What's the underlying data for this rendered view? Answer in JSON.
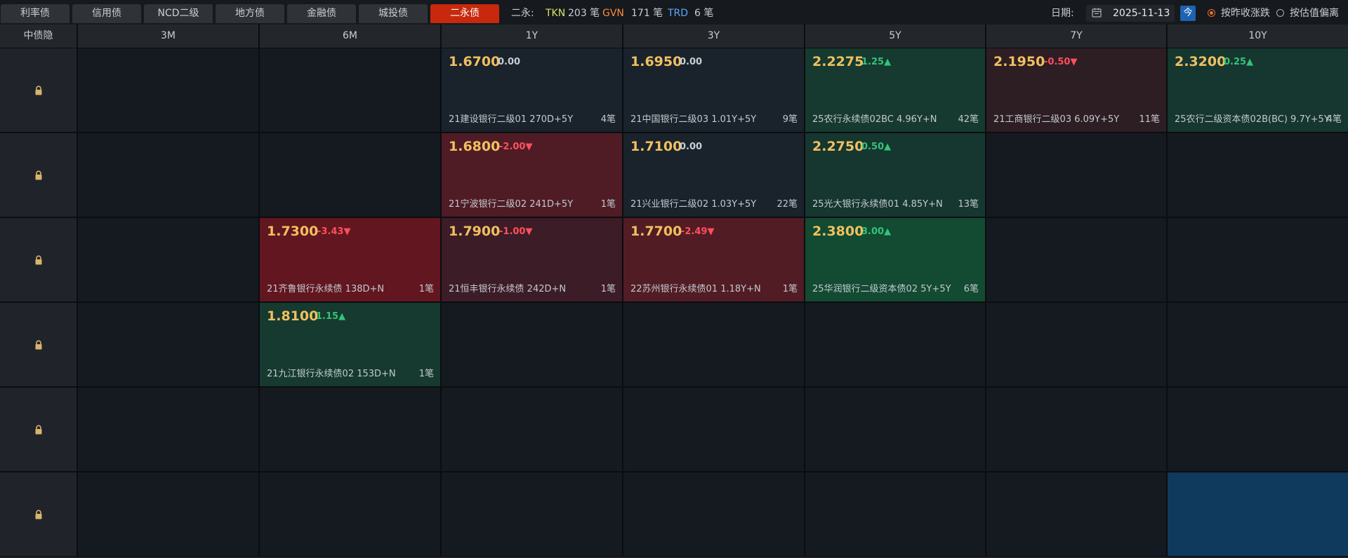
{
  "tabs": [
    {
      "label": "利率债",
      "active": false
    },
    {
      "label": "信用债",
      "active": false
    },
    {
      "label": "NCD二级",
      "active": false
    },
    {
      "label": "地方债",
      "active": false
    },
    {
      "label": "金融债",
      "active": false
    },
    {
      "label": "城投债",
      "active": false
    },
    {
      "label": "二永债",
      "active": true
    }
  ],
  "stats": {
    "prefix": "二永:",
    "items": [
      {
        "label": "TKN",
        "value": "203 笔",
        "color": "#d7e36a"
      },
      {
        "label": "GVN",
        "value": "171 笔",
        "color": "#ff8a3d"
      },
      {
        "label": "TRD",
        "value": "6 笔",
        "color": "#5aa8ff"
      }
    ]
  },
  "date": {
    "label": "日期:",
    "value": "2025-11-13",
    "today_label": "今"
  },
  "sort_options": [
    {
      "label": "按昨收涨跌",
      "selected": true
    },
    {
      "label": "按估值偏离",
      "selected": false
    }
  ],
  "columns": [
    "中债隐",
    "3M",
    "6M",
    "1Y",
    "3Y",
    "5Y",
    "7Y",
    "10Y"
  ],
  "rows": [
    {
      "cells": [
        null,
        null,
        {
          "price": "1.6700",
          "change": "0.00",
          "dir": "flat",
          "name": "21建设银行二级01 270D+5Y",
          "count": "4笔",
          "bg": "#1a222b"
        },
        {
          "price": "1.6950",
          "change": "0.00",
          "dir": "flat",
          "name": "21中国银行二级03 1.01Y+5Y",
          "count": "9笔",
          "bg": "#1a222b"
        },
        {
          "price": "2.2275",
          "change": "1.25",
          "dir": "up",
          "name": "25农行永续债02BC 4.96Y+N",
          "count": "42笔",
          "bg": "#163a2f"
        },
        {
          "price": "2.1950",
          "change": "-0.50",
          "dir": "down",
          "name": "21工商银行二级03 6.09Y+5Y",
          "count": "11笔",
          "bg": "#2d1e24"
        },
        {
          "price": "2.3200",
          "change": "0.25",
          "dir": "up",
          "name": "25农行二级资本债02B(BC) 9.7Y+5Y",
          "count": "4笔",
          "bg": "#163630"
        }
      ]
    },
    {
      "cells": [
        null,
        null,
        {
          "price": "1.6800",
          "change": "-2.00",
          "dir": "down",
          "name": "21宁波银行二级02 241D+5Y",
          "count": "1笔",
          "bg": "#4f1c26"
        },
        {
          "price": "1.7100",
          "change": "0.00",
          "dir": "flat",
          "name": "21兴业银行二级02 1.03Y+5Y",
          "count": "22笔",
          "bg": "#1a222b"
        },
        {
          "price": "2.2750",
          "change": "0.50",
          "dir": "up",
          "name": "25光大银行永续债01 4.85Y+N",
          "count": "13笔",
          "bg": "#163630"
        },
        null,
        null
      ]
    },
    {
      "cells": [
        null,
        {
          "price": "1.7300",
          "change": "-3.43",
          "dir": "down",
          "name": "21齐鲁银行永续债 138D+N",
          "count": "1笔",
          "bg": "#62161f"
        },
        {
          "price": "1.7900",
          "change": "-1.00",
          "dir": "down",
          "name": "21恒丰银行永续债 242D+N",
          "count": "1笔",
          "bg": "#3c1c26"
        },
        {
          "price": "1.7700",
          "change": "-2.49",
          "dir": "down",
          "name": "22苏州银行永续债01 1.18Y+N",
          "count": "1笔",
          "bg": "#521c24"
        },
        {
          "price": "2.3800",
          "change": "3.00",
          "dir": "up",
          "name": "25华润银行二级资本债02 5Y+5Y",
          "count": "6笔",
          "bg": "#124a32"
        },
        null,
        null
      ]
    },
    {
      "cells": [
        null,
        {
          "price": "1.8100",
          "change": "1.15",
          "dir": "up",
          "name": "21九江银行永续债02 153D+N",
          "count": "1笔",
          "bg": "#163a2f"
        },
        null,
        null,
        null,
        null,
        null
      ]
    },
    {
      "cells": [
        null,
        null,
        null,
        null,
        null,
        null,
        null
      ]
    },
    {
      "cells": [
        null,
        null,
        null,
        null,
        null,
        null,
        null
      ],
      "highlight_last": true
    }
  ],
  "colors": {
    "highlight_cell": "#0f3a5e",
    "empty_cell": "#141a20",
    "lock_icon": "#d9b46a"
  },
  "icons": {
    "lock": "lock-icon",
    "calendar": "calendar-icon",
    "up": "▲",
    "down": "▼"
  }
}
